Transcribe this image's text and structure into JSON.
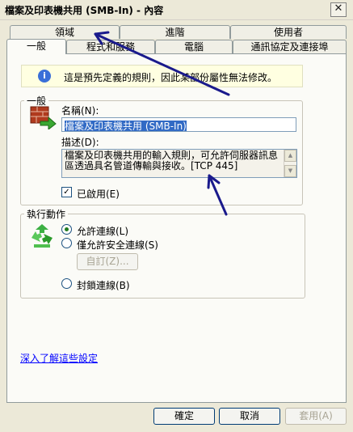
{
  "window": {
    "title": "檔案及印表機共用 (SMB-In) - 內容",
    "close_glyph": "✕"
  },
  "tabs_row1": [
    {
      "label": "領域"
    },
    {
      "label": "進階"
    },
    {
      "label": "使用者"
    }
  ],
  "tabs_row2": [
    {
      "label": "一般",
      "active": true
    },
    {
      "label": "程式和服務"
    },
    {
      "label": "電腦"
    },
    {
      "label": "通訊協定及連接埠"
    }
  ],
  "info": {
    "icon": "info-icon",
    "text": "這是預先定義的規則，因此某部份屬性無法修改。"
  },
  "general": {
    "group_label": "一般",
    "rule_icon": "firewall-rule-icon",
    "name_label": "名稱(N):",
    "name_value": "檔案及印表機共用 (SMB-In)",
    "description_label": "描述(D):",
    "description_value": "檔案及印表機共用的輸入規則，可允許伺服器訊息區透過具名管道傳輸與接收。[TCP 445]",
    "enabled_label": "已啟用(E)",
    "enabled_checked": true
  },
  "action": {
    "group_label": "執行動作",
    "action_icon": "recycle-arrows-icon",
    "options": [
      {
        "label": "允許連線(L)",
        "checked": true
      },
      {
        "label": "僅允許安全連線(S)",
        "checked": false
      },
      {
        "label": "封鎖連線(B)",
        "checked": false
      }
    ],
    "customize_label": "自訂(Z)..."
  },
  "learn_more_link": "深入了解這些設定",
  "buttons": {
    "ok": "確定",
    "cancel": "取消",
    "apply": "套用(A)"
  },
  "colors": {
    "annotation_arrow": "#1a1a8c",
    "selection": "#316ac5",
    "link": "#0000ff"
  }
}
